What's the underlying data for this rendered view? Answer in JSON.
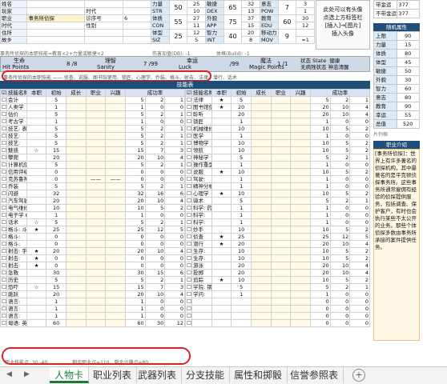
{
  "info": {
    "rows": [
      "姓名",
      "玩家",
      "职业",
      "时代",
      "住所",
      "故乡"
    ],
    "labels": {
      "era": "时代",
      "gender": "性别",
      "sn": "诊序号",
      "sn_val": "6"
    },
    "job": "事务所侦探",
    "note": "事务所侦探的本职技能=教育×2+力量或敏捷×2"
  },
  "stats": [
    {
      "cn": "力量",
      "en": "STR",
      "v": "50",
      "h": "25",
      "q": "10"
    },
    {
      "cn": "敏捷",
      "en": "DEX",
      "v": "65",
      "h": "32",
      "q": "13"
    },
    {
      "cn": "意志",
      "en": "POW",
      "v": "7",
      "h": "3",
      "q": "1"
    },
    {
      "cn": "体质",
      "en": "CON",
      "v": "55",
      "h": "27",
      "q": "11"
    },
    {
      "cn": "外貌",
      "en": "APP",
      "v": "75",
      "h": "37",
      "q": "15"
    },
    {
      "cn": "教育",
      "en": "EDU",
      "v": "60",
      "h": "30",
      "q": "12"
    },
    {
      "cn": "体型",
      "en": "SIZ",
      "v": "25",
      "h": "12",
      "q": "5"
    },
    {
      "cn": "智力",
      "en": "INT",
      "v": "40",
      "h": "20",
      "q": "8"
    },
    {
      "cn": "移动力",
      "en": "MOV",
      "v": "9",
      "h": "",
      "q": "=1"
    }
  ],
  "stat_misc": {
    "db": "伤害加值(DB): -1",
    "build": "体格(Build): -1",
    "dbn": "-1"
  },
  "portrait": [
    "此处可以有头像",
    "点选上方标签栏",
    "[插入]→[图片]",
    "插入头像"
  ],
  "bars": {
    "hp_label": "生命",
    "hp_en": "Hit Points",
    "hp": "8 /8",
    "san_label": "理智",
    "san_en": "Sanity",
    "san": "7 /99",
    "luck_label": "幸运",
    "luck_en": "Luck",
    "luck": "/99",
    "mp_label": "魔法",
    "mp_en": "Magic Points",
    "mp": "1 /1",
    "state_label": "状态 State",
    "state": "无病残状态",
    "health": "健康",
    "mind": "神志清醒"
  },
  "skills_note": "事务所侦探的本职技能 —— 侦查、说服、图书馆使用、锁匠、心理学、乔装、格斗、射击、法律、潜行、话术",
  "skills_title": "技能表",
  "skill_headers": [
    "技能名称",
    "本职",
    "初始",
    "成长",
    "职业",
    "兴趣",
    "成功率"
  ],
  "skills_left": [
    [
      "会计",
      "",
      "5",
      "",
      "",
      "",
      "5",
      "2",
      "1"
    ],
    [
      "人类学",
      "",
      "1",
      "",
      "",
      "",
      "1",
      "0",
      "0"
    ],
    [
      "估价",
      "",
      "5",
      "",
      "",
      "",
      "5",
      "2",
      "1"
    ],
    [
      "考古学",
      "",
      "1",
      "",
      "",
      "",
      "1",
      "0",
      "0"
    ],
    [
      "技艺: 表演",
      "",
      "5",
      "",
      "",
      "",
      "5",
      "2",
      "1"
    ],
    [
      "技艺:",
      "",
      "5",
      "",
      "",
      "",
      "5",
      "2",
      "1"
    ],
    [
      "技艺:",
      "",
      "5",
      "",
      "",
      "",
      "5",
      "2",
      "1"
    ],
    [
      "魅惑",
      "☆",
      "15",
      "",
      "",
      "",
      "15",
      "7",
      "3"
    ],
    [
      "攀爬",
      "",
      "20",
      "",
      "",
      "",
      "20",
      "10",
      "4"
    ],
    [
      "计算机使用 Ω",
      "",
      "5",
      "",
      "",
      "",
      "5",
      "2",
      "1"
    ],
    [
      "信用评级",
      "",
      "0",
      "",
      "",
      "",
      "0",
      "0",
      "0"
    ],
    [
      "克苏鲁神话",
      "",
      "0",
      "",
      "——",
      "——",
      "0",
      "0",
      "0"
    ],
    [
      "乔装",
      "",
      "5",
      "",
      "",
      "",
      "5",
      "2",
      "1"
    ],
    [
      "闪避",
      "",
      "32",
      "",
      "",
      "",
      "32",
      "16",
      "6"
    ],
    [
      "汽车驾驶",
      "",
      "20",
      "",
      "",
      "",
      "20",
      "10",
      "4"
    ],
    [
      "电气维修",
      "",
      "10",
      "",
      "",
      "",
      "10",
      "5",
      "2"
    ],
    [
      "电子学 Ω",
      "",
      "1",
      "",
      "",
      "",
      "1",
      "0",
      "0"
    ],
    [
      "话术",
      "☆",
      "5",
      "",
      "",
      "",
      "5",
      "2",
      "1"
    ],
    [
      "格斗: 斗殴",
      "★",
      "25",
      "",
      "",
      "",
      "25",
      "12",
      "5"
    ],
    [
      "格斗:",
      "",
      "0",
      "",
      "",
      "",
      "0",
      "0",
      "0"
    ],
    [
      "格斗:",
      "",
      "0",
      "",
      "",
      "",
      "0",
      "0",
      "0"
    ],
    [
      "射击: 手枪",
      "★",
      "20",
      "",
      "",
      "",
      "20",
      "10",
      "4"
    ],
    [
      "射击:",
      "★",
      "0",
      "",
      "",
      "",
      "0",
      "0",
      "0"
    ],
    [
      "射击:",
      "★",
      "0",
      "",
      "",
      "",
      "0",
      "0",
      "0"
    ],
    [
      "急救",
      "",
      "30",
      "",
      "",
      "",
      "30",
      "15",
      "6"
    ],
    [
      "历史",
      "",
      "5",
      "",
      "",
      "",
      "5",
      "2",
      "1"
    ],
    [
      "恐吓",
      "☆",
      "15",
      "",
      "",
      "",
      "15",
      "7",
      "3"
    ],
    [
      "跳跃",
      "",
      "20",
      "",
      "",
      "",
      "20",
      "10",
      "4"
    ],
    [
      "语言:",
      "",
      "1",
      "",
      "",
      "",
      "1",
      "0",
      "0"
    ],
    [
      "语言:",
      "",
      "1",
      "",
      "",
      "",
      "1",
      "0",
      "0"
    ],
    [
      "语言:",
      "",
      "1",
      "",
      "",
      "",
      "1",
      "0",
      "0"
    ],
    [
      "母语: 英语",
      "",
      "60",
      "",
      "",
      "",
      "60",
      "30",
      "12"
    ]
  ],
  "skills_right": [
    [
      "法律",
      "★",
      "5",
      "",
      "",
      "",
      "5",
      "2",
      "1"
    ],
    [
      "图书馆使用",
      "★",
      "20",
      "",
      "",
      "",
      "20",
      "10",
      "4"
    ],
    [
      "聆听",
      "",
      "20",
      "",
      "",
      "",
      "20",
      "10",
      "4"
    ],
    [
      "锁匠",
      "",
      "1",
      "",
      "",
      "",
      "1",
      "0",
      "0"
    ],
    [
      "机械维修",
      "",
      "10",
      "",
      "",
      "",
      "10",
      "5",
      "2"
    ],
    [
      "医学",
      "",
      "1",
      "",
      "",
      "",
      "1",
      "0",
      "0"
    ],
    [
      "博物学",
      "",
      "10",
      "",
      "",
      "",
      "10",
      "5",
      "2"
    ],
    [
      "领航",
      "",
      "10",
      "",
      "",
      "",
      "10",
      "5",
      "2"
    ],
    [
      "神秘学",
      "",
      "5",
      "",
      "",
      "",
      "5",
      "2",
      "1"
    ],
    [
      "操作重型机械",
      "",
      "1",
      "",
      "",
      "",
      "1",
      "0",
      "0"
    ],
    [
      "说服",
      "★",
      "10",
      "",
      "",
      "",
      "10",
      "5",
      "2"
    ],
    [
      "驾驶:",
      "",
      "1",
      "",
      "",
      "",
      "1",
      "0",
      "0"
    ],
    [
      "精神分析",
      "",
      "1",
      "",
      "",
      "",
      "1",
      "0",
      "0"
    ],
    [
      "心理学",
      "★",
      "10",
      "",
      "",
      "",
      "10",
      "5",
      "2"
    ],
    [
      "骑术",
      "",
      "5",
      "",
      "",
      "",
      "5",
      "2",
      "1"
    ],
    [
      "科学: 药学",
      "",
      "1",
      "",
      "",
      "",
      "1",
      "0",
      "0"
    ],
    [
      "科学:",
      "",
      "1",
      "",
      "",
      "",
      "1",
      "0",
      "0"
    ],
    [
      "科学:",
      "",
      "1",
      "",
      "",
      "",
      "1",
      "0",
      "0"
    ],
    [
      "妙手",
      "",
      "10",
      "",
      "",
      "",
      "10",
      "5",
      "2"
    ],
    [
      "侦查",
      "★",
      "25",
      "",
      "",
      "",
      "25",
      "12",
      "5"
    ],
    [
      "潜行",
      "★",
      "20",
      "",
      "",
      "",
      "20",
      "10",
      "4"
    ],
    [
      "生存:",
      "",
      "10",
      "",
      "",
      "",
      "10",
      "5",
      "2"
    ],
    [
      "生存:",
      "",
      "10",
      "",
      "",
      "",
      "10",
      "5",
      "2"
    ],
    [
      "游泳",
      "",
      "20",
      "",
      "",
      "",
      "20",
      "10",
      "4"
    ],
    [
      "投掷",
      "",
      "20",
      "",
      "",
      "",
      "20",
      "10",
      "4"
    ],
    [
      "追踪",
      "★",
      "10",
      "",
      "",
      "",
      "10",
      "5",
      "2"
    ],
    [
      "学院: 钢琴",
      "",
      "5",
      "",
      "",
      "",
      "5",
      "2",
      "1"
    ],
    [
      "学问:",
      "",
      "1",
      "",
      "",
      "",
      "1",
      "0",
      "0"
    ],
    [
      "",
      "",
      "",
      "",
      "",
      "",
      "0",
      "0",
      "0"
    ],
    [
      "",
      "",
      "",
      "",
      "",
      "",
      "0",
      "0",
      "0"
    ],
    [
      "",
      "",
      "",
      "",
      "",
      "",
      "0",
      "0",
      "0"
    ],
    [
      "",
      "",
      "",
      "",
      "",
      "",
      "0",
      "0",
      "0"
    ]
  ],
  "footer_left": "职业技能点: 30 -40",
  "footer_mid": "剩余职业点=210，剩余兴趣点=80",
  "side": {
    "top_label": "带金运",
    "top_val": "377",
    "top2_label": "不带金运",
    "top2_val": "377",
    "random_title": "随机属性",
    "rows": [
      [
        "上限",
        "90"
      ],
      [
        "力量",
        "15"
      ],
      [
        "体质",
        "80"
      ],
      [
        "体型",
        "45"
      ],
      [
        "敏捷",
        "50"
      ],
      [
        "外貌",
        "30"
      ],
      [
        "智力",
        "60"
      ],
      [
        "意志",
        "80"
      ],
      [
        "教育",
        "90"
      ],
      [
        "幸运",
        "55"
      ],
      [
        "总值",
        "520"
      ]
    ],
    "desc_label": "片剂框",
    "job_title": "职业介绍",
    "job_text": "[事务所侦探]：世界上有许多著名的侦探机构，其中最著名的是平克顿侦探事务所。这些事务所通常雇佣有经验的侦探提供服务，包括调查、保护客户，有时也会执行某些不太公开的业务。那些个体侦探多数由事务所承接的案件提供任务。"
  },
  "tabs": [
    "人物卡",
    "职业列表",
    "武器列表",
    "分支技能",
    "属性和掷骰",
    "信誉参照表"
  ],
  "tab_active": "人物卡",
  "colors": {
    "accent": "#1f4e79",
    "tab_green": "#1b7a3a",
    "oval": "#e02020"
  }
}
